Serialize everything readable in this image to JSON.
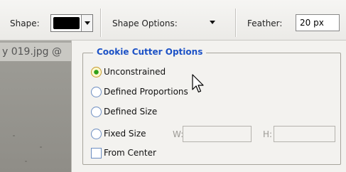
{
  "toolbar": {
    "shape_label": "Shape:",
    "shape_options_label": "Shape Options:",
    "feather_label": "Feather:",
    "feather_value": "20 px"
  },
  "document": {
    "tab_title": "y 019.jpg @"
  },
  "cookie_cutter": {
    "title": "Cookie Cutter Options",
    "options": [
      {
        "label": "Unconstrained",
        "selected": true
      },
      {
        "label": "Defined Proportions",
        "selected": false
      },
      {
        "label": "Defined Size",
        "selected": false
      },
      {
        "label": "Fixed Size",
        "selected": false
      }
    ],
    "width_label": "W:",
    "height_label": "H:",
    "from_center_label": "From Center",
    "from_center_checked": false
  },
  "icons": {
    "dropdown": "chevron-down-icon",
    "cursor": "mouse-cursor-icon"
  },
  "colors": {
    "accent_title": "#1d52c6",
    "radio_selected": "#2ea11a",
    "swatch": "#000000"
  }
}
